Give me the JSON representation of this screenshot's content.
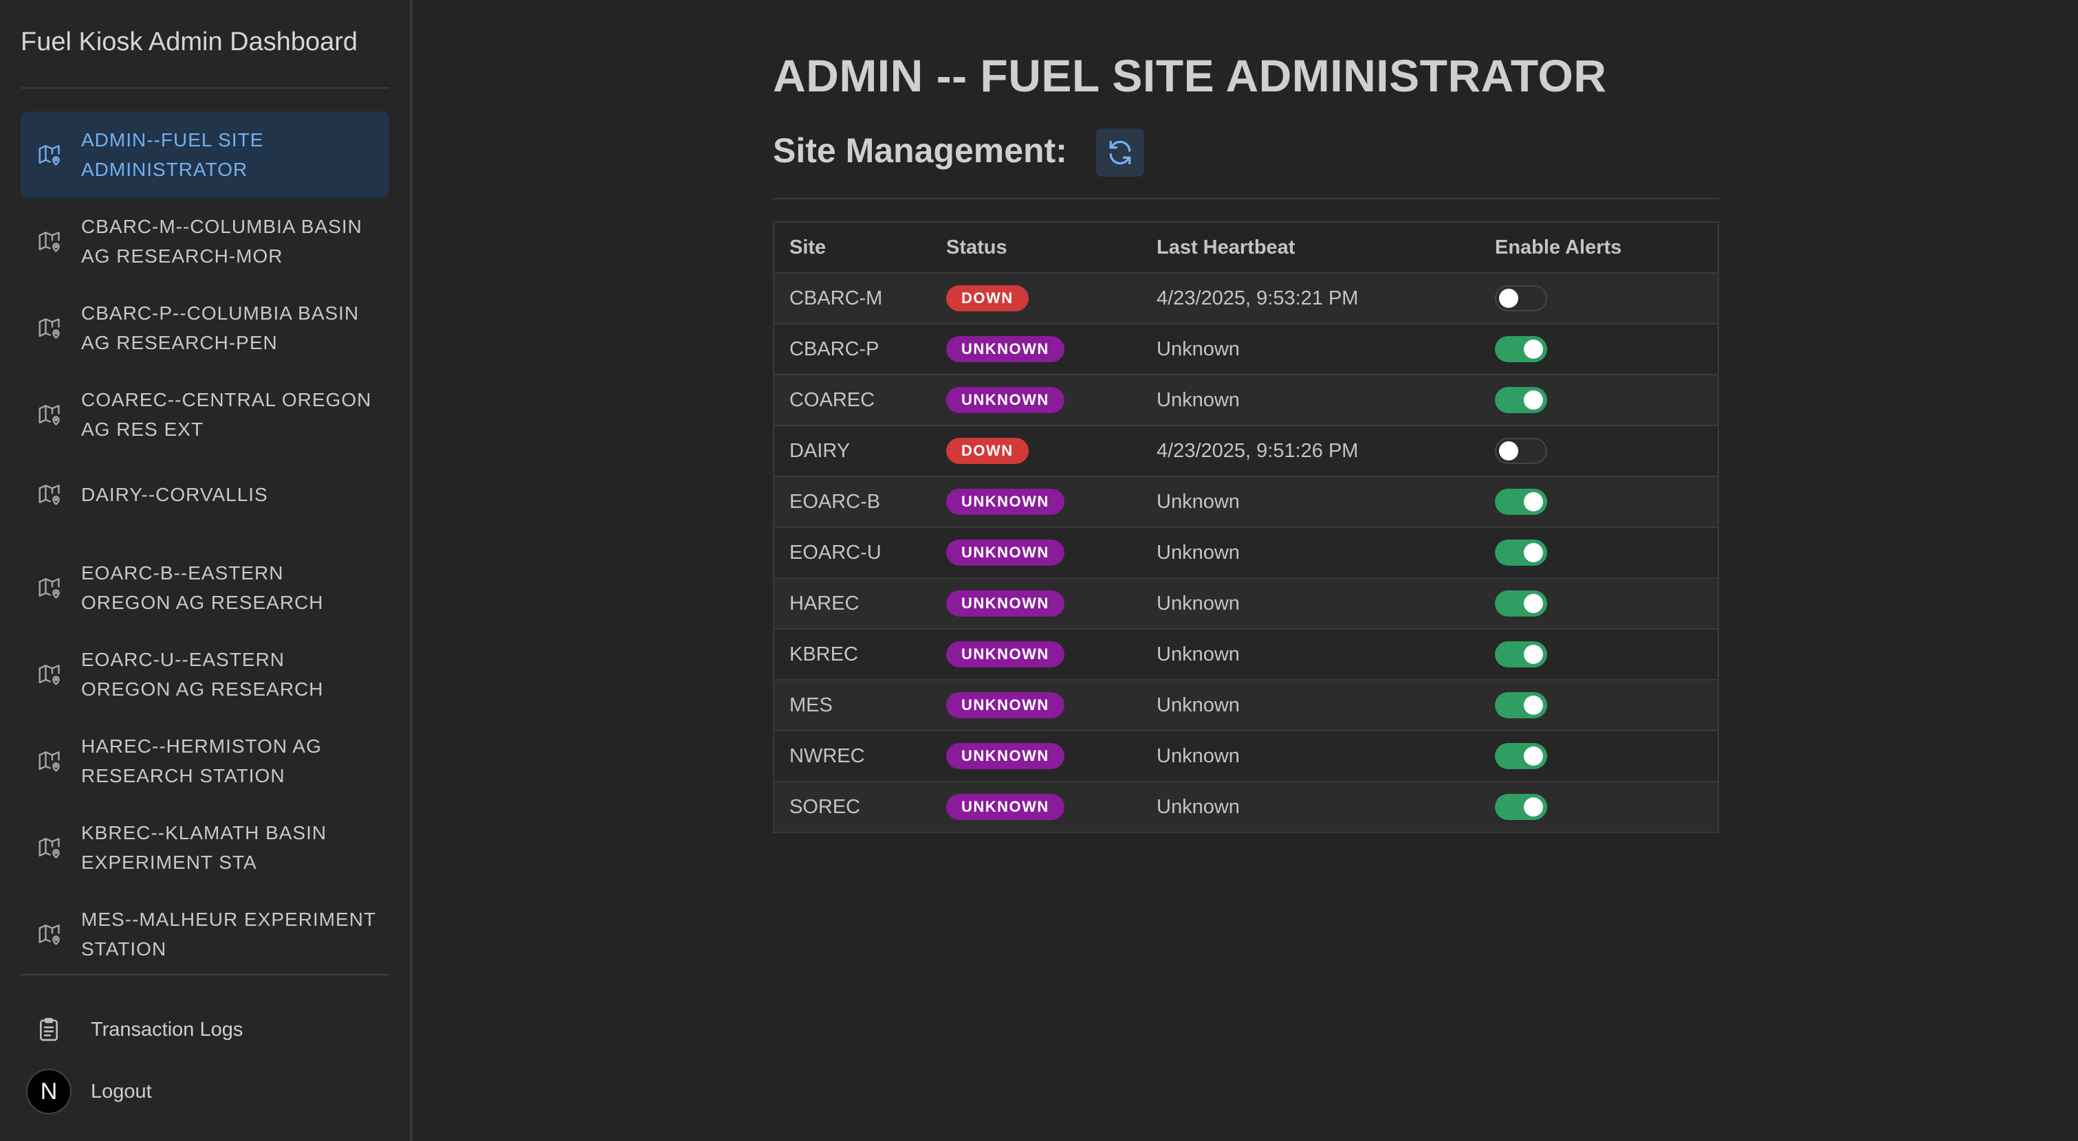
{
  "app": {
    "title": "Fuel Kiosk Admin Dashboard"
  },
  "sidebar": {
    "items": [
      {
        "label": "ADMIN--FUEL SITE ADMINISTRATOR",
        "icon": "map-pin-icon",
        "active": true
      },
      {
        "label": "CBARC-M--COLUMBIA BASIN AG RESEARCH-MOR",
        "icon": "map-pin-icon"
      },
      {
        "label": "CBARC-P--COLUMBIA BASIN AG RESEARCH-PEN",
        "icon": "map-pin-icon"
      },
      {
        "label": "COAREC--CENTRAL OREGON AG RES EXT",
        "icon": "map-pin-icon"
      },
      {
        "label": "DAIRY--CORVALLIS",
        "icon": "map-pin-icon"
      },
      {
        "label": "EOARC-B--EASTERN OREGON AG RESEARCH",
        "icon": "map-pin-icon"
      },
      {
        "label": "EOARC-U--EASTERN OREGON AG RESEARCH",
        "icon": "map-pin-icon"
      },
      {
        "label": "HAREC--HERMISTON AG RESEARCH STATION",
        "icon": "map-pin-icon"
      },
      {
        "label": "KBREC--KLAMATH BASIN EXPERIMENT STA",
        "icon": "map-pin-icon"
      },
      {
        "label": "MES--MALHEUR EXPERIMENT STATION",
        "icon": "map-pin-icon"
      }
    ],
    "transaction_logs": "Transaction Logs",
    "logout": "Logout",
    "avatar_letter": "N"
  },
  "main": {
    "title": "ADMIN -- FUEL SITE ADMINISTRATOR",
    "section_title": "Site Management:",
    "table": {
      "headers": [
        "Site",
        "Status",
        "Last Heartbeat",
        "Enable Alerts"
      ],
      "rows": [
        {
          "site": "CBARC-M",
          "status": "DOWN",
          "heartbeat": "4/23/2025, 9:53:21 PM",
          "alerts": false
        },
        {
          "site": "CBARC-P",
          "status": "UNKNOWN",
          "heartbeat": "Unknown",
          "alerts": true
        },
        {
          "site": "COAREC",
          "status": "UNKNOWN",
          "heartbeat": "Unknown",
          "alerts": true
        },
        {
          "site": "DAIRY",
          "status": "DOWN",
          "heartbeat": "4/23/2025, 9:51:26 PM",
          "alerts": false
        },
        {
          "site": "EOARC-B",
          "status": "UNKNOWN",
          "heartbeat": "Unknown",
          "alerts": true
        },
        {
          "site": "EOARC-U",
          "status": "UNKNOWN",
          "heartbeat": "Unknown",
          "alerts": true
        },
        {
          "site": "HAREC",
          "status": "UNKNOWN",
          "heartbeat": "Unknown",
          "alerts": true
        },
        {
          "site": "KBREC",
          "status": "UNKNOWN",
          "heartbeat": "Unknown",
          "alerts": true
        },
        {
          "site": "MES",
          "status": "UNKNOWN",
          "heartbeat": "Unknown",
          "alerts": true
        },
        {
          "site": "NWREC",
          "status": "UNKNOWN",
          "heartbeat": "Unknown",
          "alerts": true
        },
        {
          "site": "SOREC",
          "status": "UNKNOWN",
          "heartbeat": "Unknown",
          "alerts": true
        }
      ]
    }
  },
  "colors": {
    "status_down": "#d23a3a",
    "status_unknown": "#8a1b9a",
    "toggle_on": "#2f9e63",
    "active_nav_bg": "#22344a",
    "active_nav_text": "#74b0f0"
  }
}
